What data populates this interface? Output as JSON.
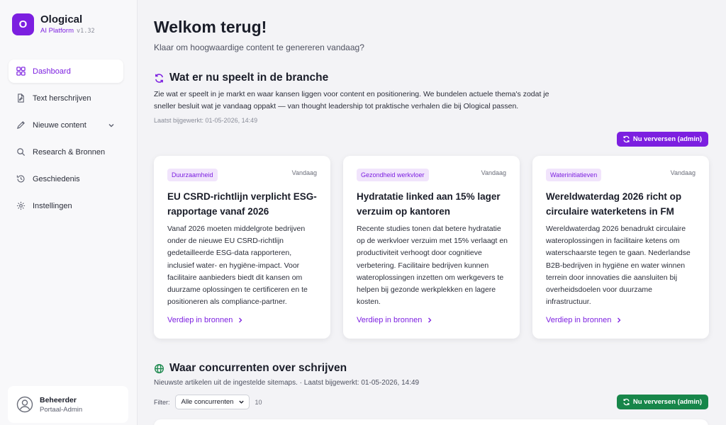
{
  "brand": {
    "logo_letter": "O",
    "name": "Ological",
    "subtitle": "AI Platform",
    "version": "v1.32"
  },
  "nav": {
    "items": [
      {
        "label": "Dashboard",
        "icon": "grid-icon",
        "active": true
      },
      {
        "label": "Text herschrijven",
        "icon": "document-edit-icon"
      },
      {
        "label": "Nieuwe content",
        "icon": "pen-icon",
        "has_chevron": true
      },
      {
        "label": "Research & Bronnen",
        "icon": "search-icon"
      },
      {
        "label": "Geschiedenis",
        "icon": "history-icon"
      },
      {
        "label": "Instellingen",
        "icon": "gear-icon"
      }
    ]
  },
  "user": {
    "name": "Beheerder",
    "role": "Portaal-Admin"
  },
  "header": {
    "title": "Welkom terug!",
    "subtitle": "Klaar om hoogwaardige content te genereren vandaag?"
  },
  "trends": {
    "title": "Wat er nu speelt in de branche",
    "description": "Zie wat er speelt in je markt en waar kansen liggen voor content en positionering. We bundelen actuele thema's zodat je sneller besluit wat je vandaag oppakt — van thought leadership tot praktische verhalen die bij Ological passen.",
    "updated": "Laatst bijgewerkt: 01-05-2026, 14:49",
    "refresh_label": "Nu verversen (admin)",
    "cards": [
      {
        "tag": "Duurzaamheid",
        "date": "Vandaag",
        "title": "EU CSRD-richtlijn verplicht ESG-rapportage vanaf 2026",
        "body": "Vanaf 2026 moeten middelgrote bedrijven onder de nieuwe EU CSRD-richtlijn gedetailleerde ESG-data rapporteren, inclusief water- en hygiëne-impact. Voor facilitaire aanbieders biedt dit kansen om duurzame oplossingen te certificeren en te positioneren als compliance-partner.",
        "link": "Verdiep in bronnen"
      },
      {
        "tag": "Gezondheid werkvloer",
        "date": "Vandaag",
        "title": "Hydratatie linked aan 15% lager verzuim op kantoren",
        "body": "Recente studies tonen dat betere hydratatie op de werkvloer verzuim met 15% verlaagt en productiviteit verhoogt door cognitieve verbetering. Facilitaire bedrijven kunnen wateroplossingen inzetten om werkgevers te helpen bij gezonde werkplekken en lagere kosten.",
        "link": "Verdiep in bronnen"
      },
      {
        "tag": "Waterinitiatieven",
        "date": "Vandaag",
        "title": "Wereldwaterdag 2026 richt op circulaire waterketens in FM",
        "body": "Wereldwaterdag 2026 benadrukt circulaire wateroplossingen in facilitaire ketens om waterschaarste tegen te gaan. Nederlandse B2B-bedrijven in hygiëne en water winnen terrein door innovaties die aansluiten bij overheidsdoelen voor duurzame infrastructuur.",
        "link": "Verdiep in bronnen"
      }
    ]
  },
  "competitors": {
    "title": "Waar concurrenten over schrijven",
    "description": "Nieuwste artikelen uit de ingestelde sitemaps. · Laatst bijgewerkt: 01-05-2026, 14:49",
    "filter_label": "Filter:",
    "filter_value": "Alle concurrenten",
    "count": "10",
    "refresh_label": "Nu verversen (admin)"
  },
  "colors": {
    "accent": "#7c1fe0",
    "green": "#17864a",
    "tag_bg": "#f1e4fc"
  }
}
